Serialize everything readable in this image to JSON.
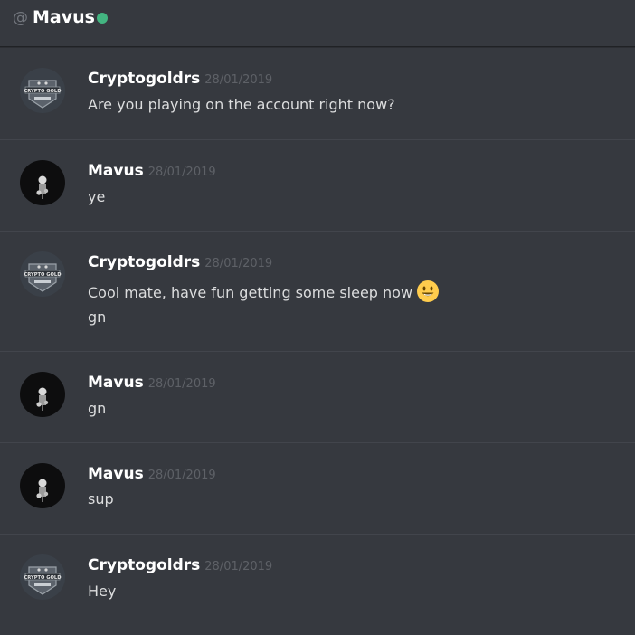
{
  "header": {
    "at_symbol": "@",
    "recipient": "Mavus",
    "status_color": "#43b581"
  },
  "messages": [
    {
      "author": "Cryptogoldrs",
      "timestamp": "28/01/2019",
      "lines": [
        "Are you playing on the account right now?"
      ],
      "avatar": "crypto-gold-avatar"
    },
    {
      "author": "Mavus",
      "timestamp": "28/01/2019",
      "lines": [
        "ye"
      ],
      "avatar": "dark-figure-avatar"
    },
    {
      "author": "Cryptogoldrs",
      "timestamp": "28/01/2019",
      "lines": [
        "Cool mate, have fun getting some sleep now",
        "gn"
      ],
      "emoji": "smiley-emoji",
      "avatar": "crypto-gold-avatar"
    },
    {
      "author": "Mavus",
      "timestamp": "28/01/2019",
      "lines": [
        "gn"
      ],
      "avatar": "dark-figure-avatar"
    },
    {
      "author": "Mavus",
      "timestamp": "28/01/2019",
      "lines": [
        "sup"
      ],
      "avatar": "dark-figure-avatar"
    },
    {
      "author": "Cryptogoldrs",
      "timestamp": "28/01/2019",
      "lines": [
        "Hey"
      ],
      "avatar": "crypto-gold-avatar"
    }
  ],
  "avatar_text": {
    "crypto_gold": "CRYPTO GOLD"
  },
  "colors": {
    "background": "#36393f",
    "username": "#ffffff",
    "timestamp": "#5e6167",
    "message_text": "#dcddde",
    "divider": "#4f545c"
  }
}
